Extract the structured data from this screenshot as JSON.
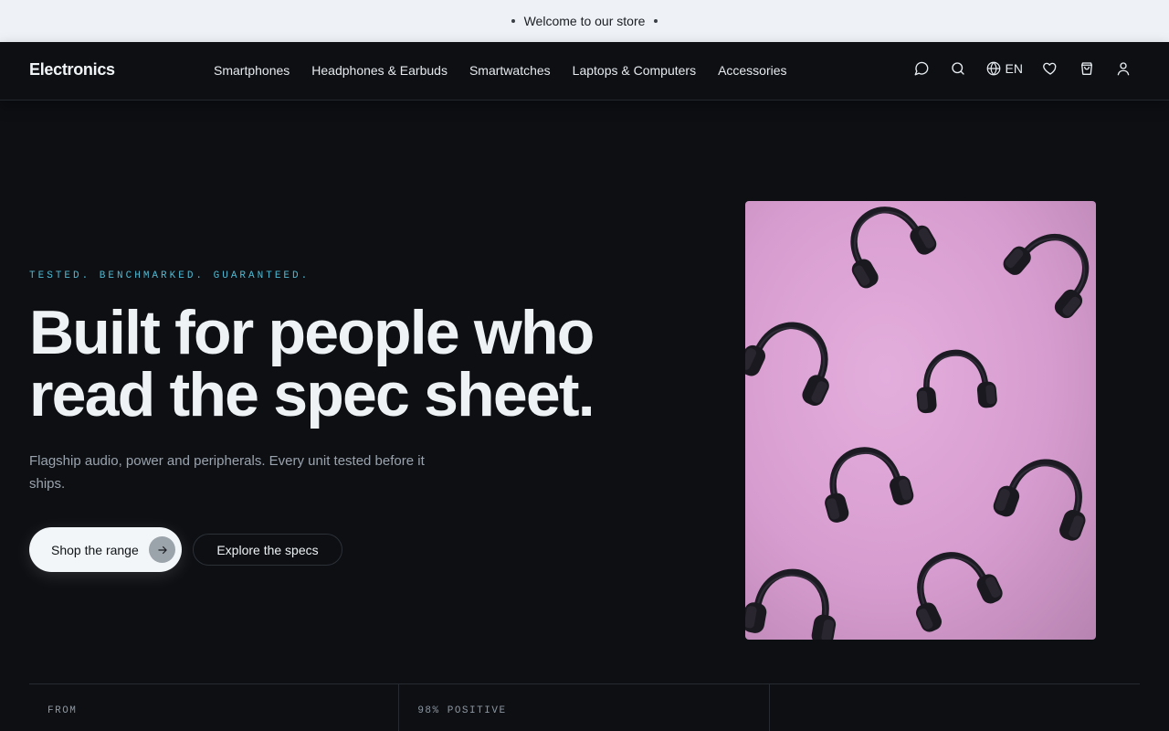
{
  "announcement": {
    "text": "Welcome to our store"
  },
  "header": {
    "logo": "Electronics",
    "nav": [
      "Smartphones",
      "Headphones & Earbuds",
      "Smartwatches",
      "Laptops & Computers",
      "Accessories"
    ],
    "language": "EN",
    "icons": [
      "chat-icon",
      "search-icon",
      "globe-icon",
      "heart-icon",
      "cart-icon",
      "user-icon"
    ]
  },
  "hero": {
    "eyebrow": "TESTED. BENCHMARKED. GUARANTEED.",
    "headline_line1": "Built for people who",
    "headline_line2": "read the spec sheet.",
    "subtext": "Flagship audio, power and peripherals. Every unit tested before it ships.",
    "primary_cta": "Shop the range",
    "secondary_cta": "Explore the specs",
    "image_alt": "headphones-on-pink-background"
  },
  "stats": [
    {
      "label": "FROM"
    },
    {
      "label": "98% POSITIVE"
    },
    {
      "label": ""
    }
  ],
  "colors": {
    "background": "#0d0f13",
    "accent": "#4fb9d2",
    "announcement_bg": "#eef2f6",
    "image_pink": "#d79ccf"
  }
}
